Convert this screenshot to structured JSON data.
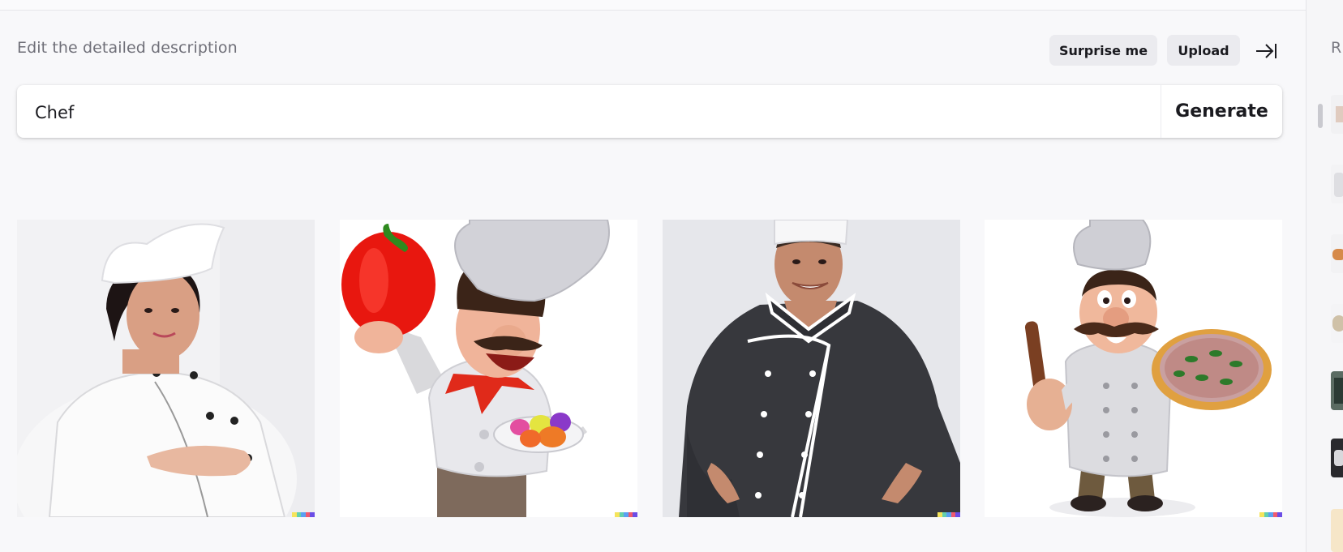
{
  "header": {
    "title": "Edit the detailed description",
    "surprise_label": "Surprise me",
    "upload_label": "Upload"
  },
  "prompt": {
    "value": "Chef",
    "generate_label": "Generate"
  },
  "results": [
    {
      "alt": "Female chef in white uniform"
    },
    {
      "alt": "Cartoon chef holding red pepper"
    },
    {
      "alt": "Chef in black jacket"
    },
    {
      "alt": "Cartoon chef with pizza"
    }
  ],
  "sidebar": {
    "label": "R"
  },
  "colors": {
    "signature": [
      "#f5e45b",
      "#63d0ad",
      "#5aa0f2",
      "#ef5a6f",
      "#6b4de6"
    ]
  }
}
